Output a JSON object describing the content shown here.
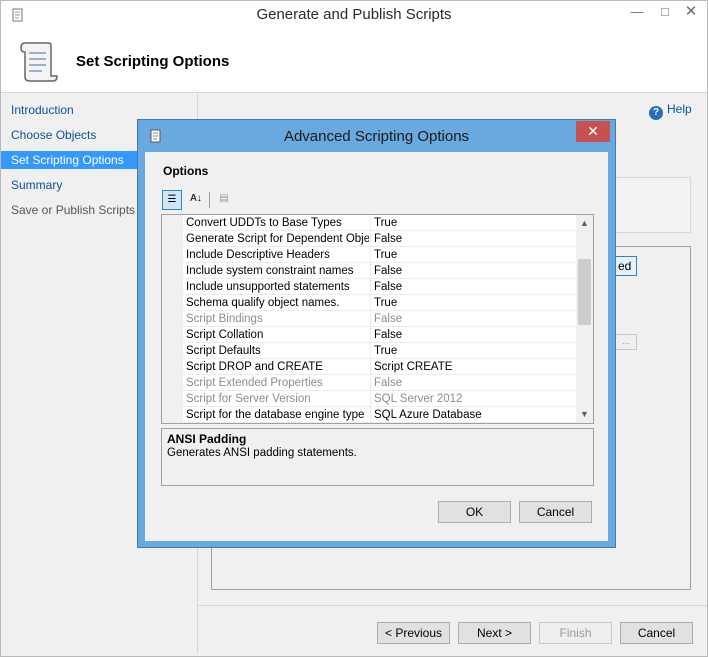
{
  "main": {
    "title": "Generate and Publish Scripts",
    "header_title": "Set Scripting Options",
    "nav": [
      {
        "label": "Introduction",
        "state": "link"
      },
      {
        "label": "Choose Objects",
        "state": "link"
      },
      {
        "label": "Set Scripting Options",
        "state": "active"
      },
      {
        "label": "Summary",
        "state": "link"
      },
      {
        "label": "Save or Publish Scripts",
        "state": "disabled"
      }
    ],
    "help_label": "Help",
    "background_button_fragment": "ed",
    "background_browse_button": "...",
    "buttons": {
      "previous": "< Previous",
      "next": "Next >",
      "finish": "Finish",
      "cancel": "Cancel"
    }
  },
  "dialog": {
    "title": "Advanced Scripting Options",
    "options_label": "Options",
    "properties": [
      {
        "name": "Convert UDDTs to Base Types",
        "value": "True",
        "enabled": true
      },
      {
        "name": "Generate Script for Dependent Objects",
        "value": "False",
        "enabled": true
      },
      {
        "name": "Include Descriptive Headers",
        "value": "True",
        "enabled": true
      },
      {
        "name": "Include system constraint names",
        "value": "False",
        "enabled": true
      },
      {
        "name": "Include unsupported statements",
        "value": "False",
        "enabled": true
      },
      {
        "name": "Schema qualify object names.",
        "value": "True",
        "enabled": true
      },
      {
        "name": "Script Bindings",
        "value": "False",
        "enabled": false
      },
      {
        "name": "Script Collation",
        "value": "False",
        "enabled": true
      },
      {
        "name": "Script Defaults",
        "value": "True",
        "enabled": true
      },
      {
        "name": "Script DROP and CREATE",
        "value": "Script CREATE",
        "enabled": true
      },
      {
        "name": "Script Extended Properties",
        "value": "False",
        "enabled": false
      },
      {
        "name": "Script for Server Version",
        "value": "SQL Server 2012",
        "enabled": false
      },
      {
        "name": "Script for the database engine type",
        "value": "SQL Azure Database",
        "enabled": true
      }
    ],
    "description": {
      "title": "ANSI Padding",
      "text": "Generates ANSI padding statements."
    },
    "ok_label": "OK",
    "cancel_label": "Cancel"
  },
  "colors": {
    "accent": "#3399ff",
    "dialog_frame": "#6aa9e0",
    "close_button": "#c75050",
    "link": "#0b4f9d"
  }
}
